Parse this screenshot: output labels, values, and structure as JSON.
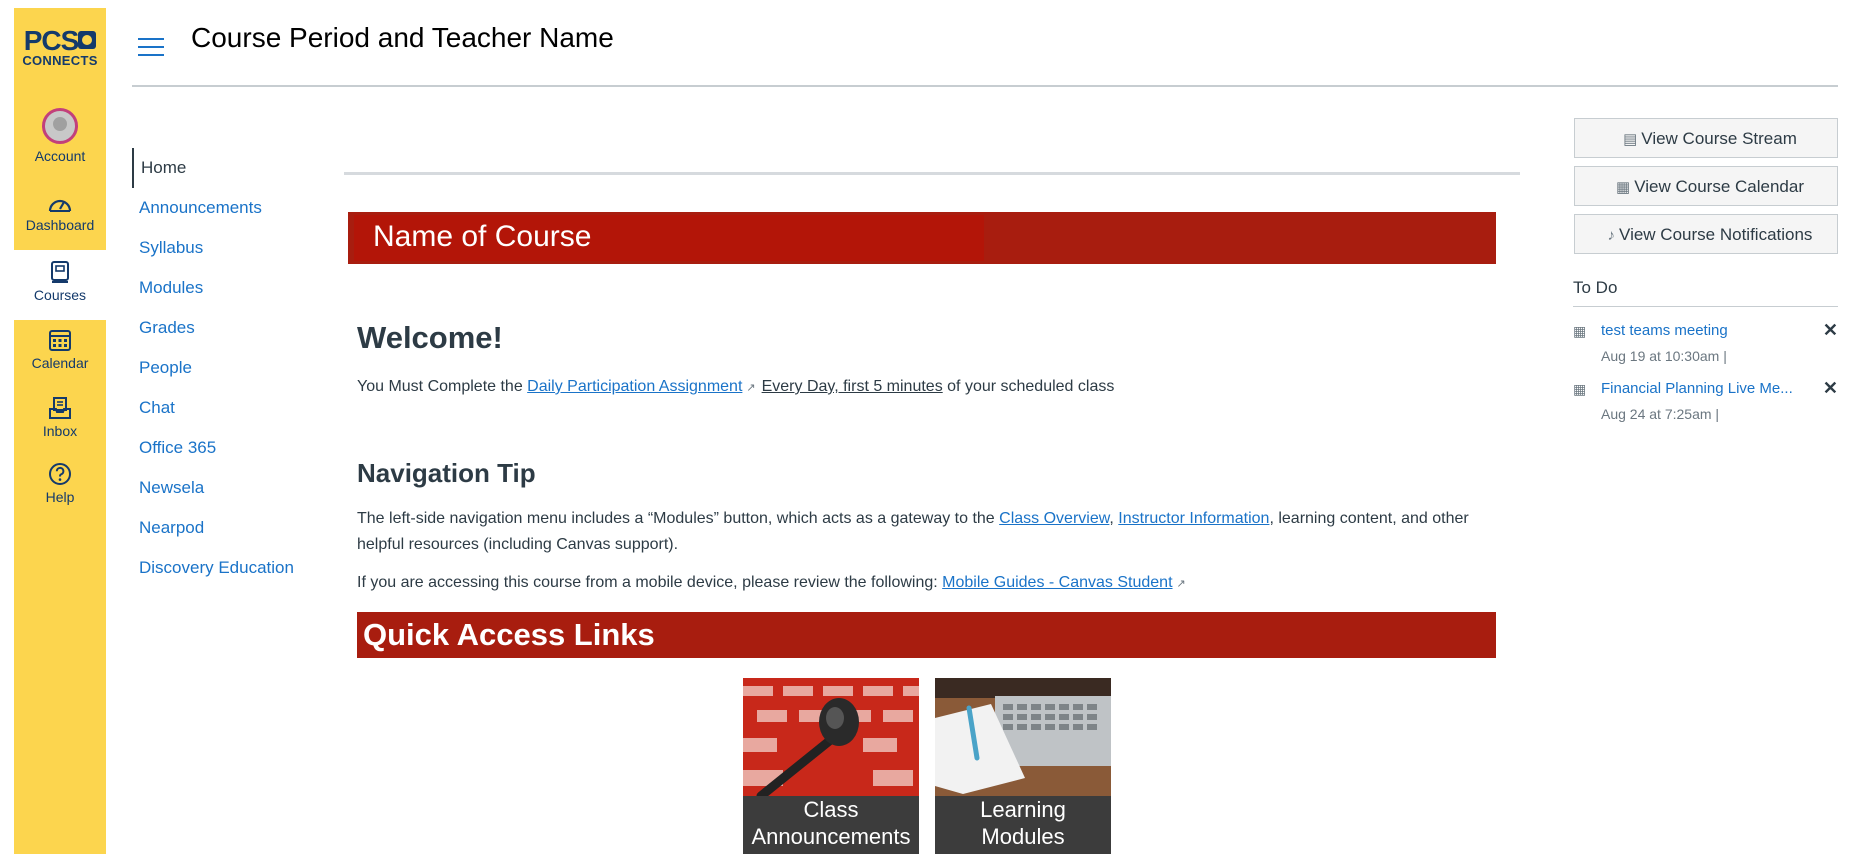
{
  "brand": {
    "line1": "PCS",
    "line2": "CONNECTS"
  },
  "global_nav": [
    {
      "label": "Account",
      "icon": "avatar"
    },
    {
      "label": "Dashboard",
      "icon": "dashboard-icon"
    },
    {
      "label": "Courses",
      "icon": "courses-icon"
    },
    {
      "label": "Calendar",
      "icon": "calendar-icon"
    },
    {
      "label": "Inbox",
      "icon": "inbox-icon"
    },
    {
      "label": "Help",
      "icon": "help-icon"
    }
  ],
  "header": {
    "title": "Course Period and Teacher Name"
  },
  "course_nav": [
    "Home",
    "Announcements",
    "Syllabus",
    "Modules",
    "Grades",
    "People",
    "Chat",
    "Office 365",
    "Newsela",
    "Nearpod",
    "Discovery Education"
  ],
  "main": {
    "course_banner": "Name of Course",
    "welcome": "Welcome!",
    "intro": {
      "prefix": "You Must Complete the ",
      "link": "Daily Participation Assignment",
      "underlined": "Every Day, first 5 minutes",
      "suffix": " of your scheduled class"
    },
    "nav_tip_heading": "Navigation Tip",
    "nav_tip": {
      "part1": "The left-side navigation menu includes a “Modules” button, which acts as a gateway to the ",
      "link1": "Class Overview",
      "sep": ", ",
      "link2": "Instructor Information",
      "part2": ", learning content, and other helpful resources (including Canvas support)."
    },
    "mobile": {
      "prefix": "If you are accessing this course from a mobile device, please review the following: ",
      "link": "Mobile Guides - Canvas Student"
    },
    "quick_links_heading": "Quick Access Links",
    "tiles": [
      {
        "line1": "Class",
        "line2": "Announcements"
      },
      {
        "line1": "Learning",
        "line2": "Modules"
      }
    ]
  },
  "sidebar": {
    "buttons": [
      {
        "label": "View Course Stream",
        "icon": "stream-icon"
      },
      {
        "label": "View Course Calendar",
        "icon": "calendar-icon"
      },
      {
        "label": "View Course Notifications",
        "icon": "bell-icon"
      }
    ],
    "todo_title": "To Do",
    "todo": [
      {
        "title": "test teams meeting",
        "date": "Aug 19 at 10:30am  |"
      },
      {
        "title": "Financial Planning Live Me...",
        "date": "Aug 24 at 7:25am  |"
      }
    ]
  },
  "colors": {
    "global_nav_bg": "#fcd54e",
    "banner_red": "#a81d0f",
    "link_blue": "#1a73c8",
    "brand_navy": "#143a6b"
  }
}
